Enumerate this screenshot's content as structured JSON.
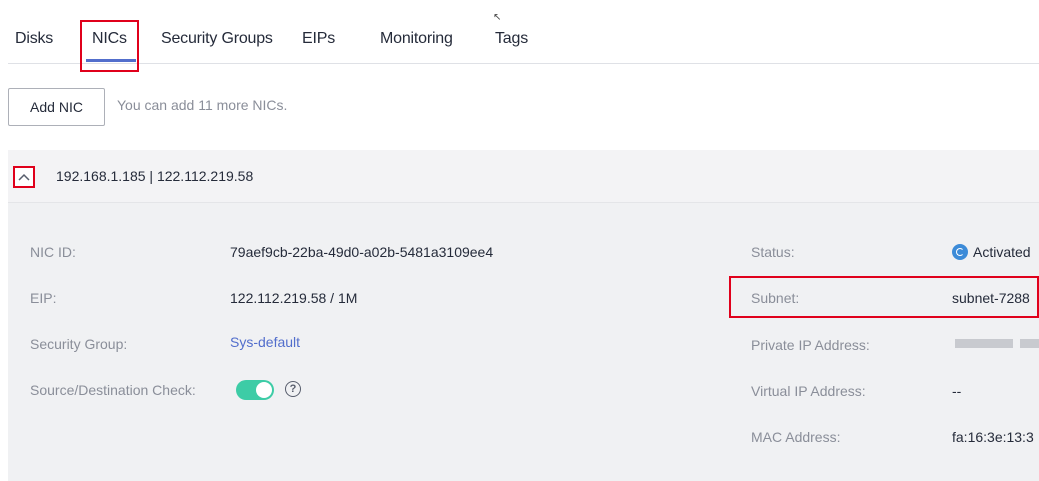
{
  "tabs": [
    {
      "label": "Disks",
      "active": false
    },
    {
      "label": "NICs",
      "active": true
    },
    {
      "label": "Security Groups",
      "active": false
    },
    {
      "label": "EIPs",
      "active": false
    },
    {
      "label": "Monitoring",
      "active": false
    },
    {
      "label": "Tags",
      "active": false
    }
  ],
  "toolbar": {
    "add_button": "Add NIC",
    "hint": "You can add 11 more NICs."
  },
  "nic": {
    "title": "192.168.1.185 | 122.112.219.58",
    "expanded": true,
    "left": {
      "nic_id_label": "NIC ID:",
      "nic_id_value": "79aef9cb-22ba-49d0-a02b-5481a3109ee4",
      "eip_label": "EIP:",
      "eip_value": "122.112.219.58 / 1M",
      "sg_label": "Security Group:",
      "sg_value": "Sys-default",
      "sdc_label": "Source/Destination Check:",
      "sdc_enabled": true
    },
    "right": {
      "status_label": "Status:",
      "status_value": "Activated",
      "subnet_label": "Subnet:",
      "subnet_value": "subnet-7288",
      "private_ip_label": "Private IP Address:",
      "virtual_ip_label": "Virtual IP Address:",
      "virtual_ip_value": "--",
      "mac_label": "MAC Address:",
      "mac_value": "fa:16:3e:13:3"
    }
  },
  "colors": {
    "accent": "#526ecc",
    "toggle_on": "#3dcca6",
    "highlight": "#e0001b",
    "status": "#3c8bd8"
  },
  "icons": {
    "collapse": "chevron-up-icon",
    "help": "help-circle-icon",
    "status": "activated-status-icon"
  }
}
